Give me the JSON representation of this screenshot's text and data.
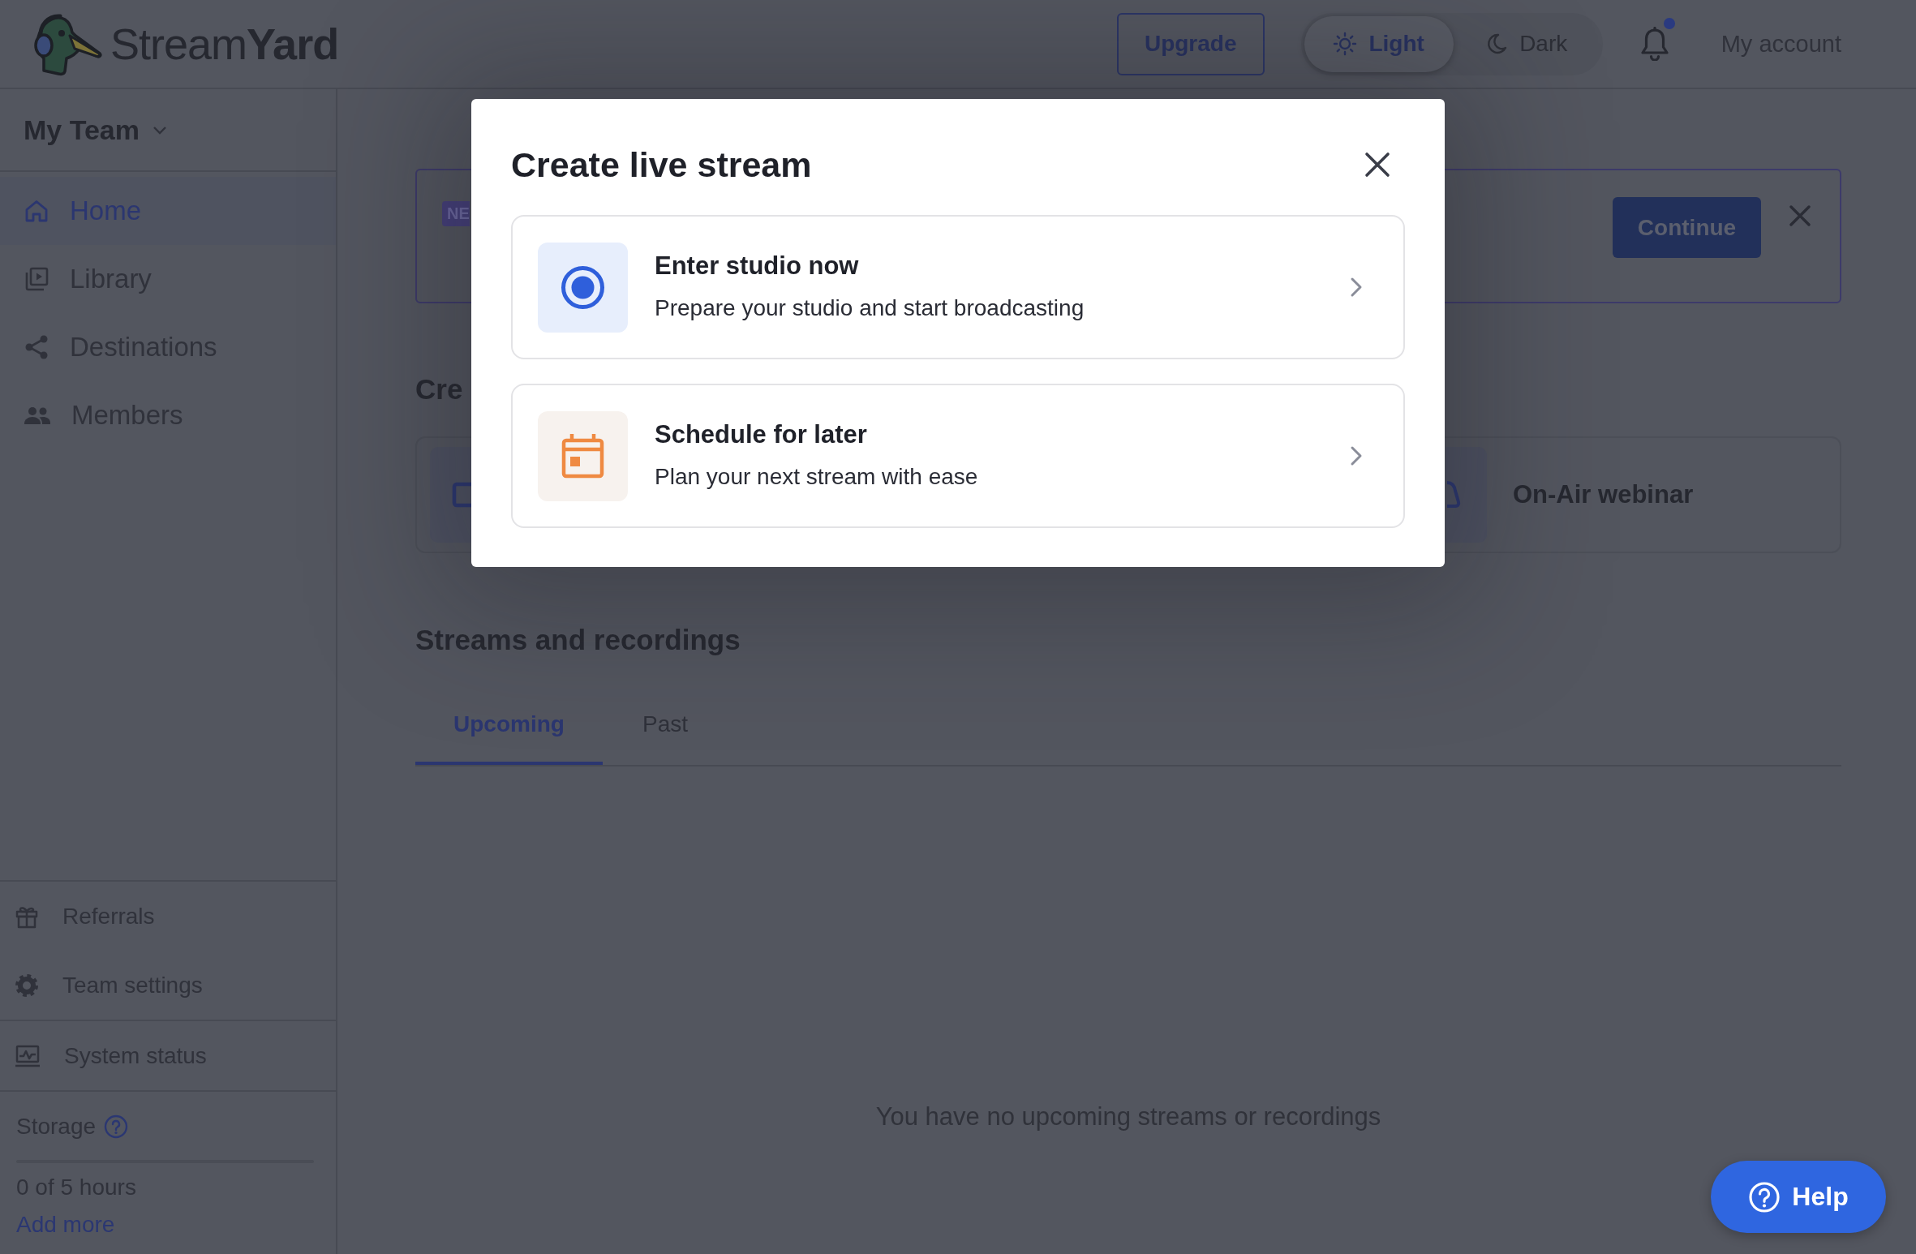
{
  "header": {
    "logo": "Stream**Yard**",
    "upgrade_button": "Upgrade",
    "theme_options": [
      {
        "label": "Light",
        "selected": true
      },
      {
        "label": "Dark",
        "selected": false
      }
    ],
    "account_link": "My account"
  },
  "sidebar": {
    "team": "My Team",
    "nav_items": [
      {
        "label": "Home",
        "selected": true
      },
      {
        "label": "Library",
        "selected": false
      },
      {
        "label": "Destinations",
        "selected": false
      },
      {
        "label": "Members",
        "selected": false
      }
    ],
    "footer_items": [
      "Referrals",
      "Team settings",
      "System status"
    ],
    "storage": {
      "label": "Storage",
      "level": 0,
      "usage": "0 of 5 hours",
      "add_more_link": "Add more"
    }
  },
  "main": {
    "banner": {
      "badge": "NE",
      "continue_button": "Continue"
    },
    "create_heading": "Cre",
    "create_option_label": "On-Air webinar",
    "streams": {
      "heading": "Streams and recordings",
      "tabs": [
        {
          "label": "Upcoming",
          "selected": true
        },
        {
          "label": "Past",
          "selected": false
        }
      ],
      "empty_message": "You have no upcoming streams or recordings"
    }
  },
  "modal": {
    "title": "Create live stream",
    "options": [
      {
        "kind": "studio",
        "title": "Enter studio now",
        "description": "Prepare your studio and start broadcasting"
      },
      {
        "kind": "schedule",
        "title": "Schedule for later",
        "description": "Plan your next stream with ease"
      }
    ]
  },
  "help_button": "Help"
}
